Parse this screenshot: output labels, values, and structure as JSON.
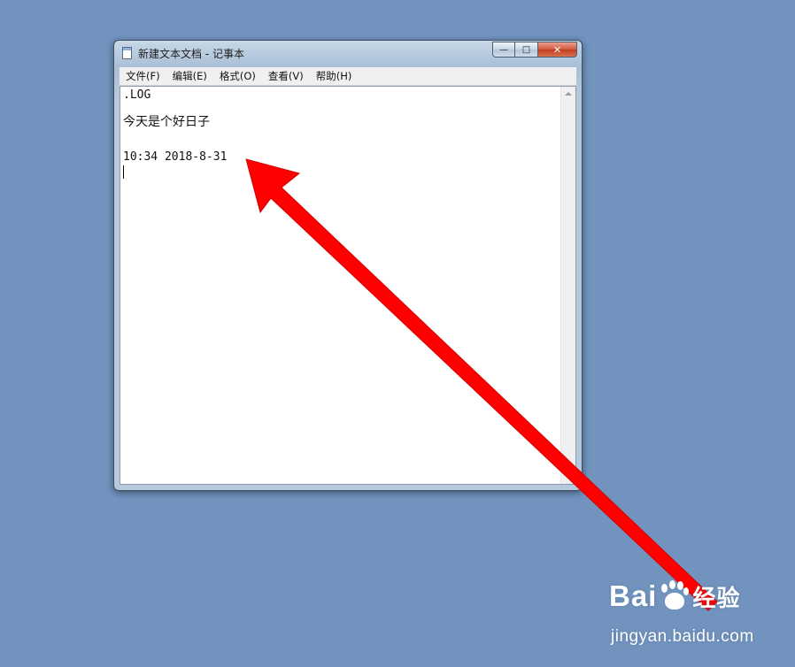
{
  "window": {
    "title": "新建文本文档 - 记事本",
    "controls": {
      "minimize": "—",
      "maximize": "□",
      "close": "✕"
    }
  },
  "menu": [
    "文件(F)",
    "编辑(E)",
    "格式(O)",
    "查看(V)",
    "帮助(H)"
  ],
  "editor": {
    "line1": ".LOG",
    "line2": "今天是个好日子",
    "line3": "10:34 2018-8-31"
  },
  "watermark": {
    "logo": "Bai",
    "logo_suffix": "经验",
    "url": "jingyan.baidu.com"
  },
  "colors": {
    "desktop": "#7193be",
    "annotation_arrow": "#ff0000"
  },
  "icons": {
    "app": "notepad-icon",
    "annotation": "red-arrow-icon"
  }
}
